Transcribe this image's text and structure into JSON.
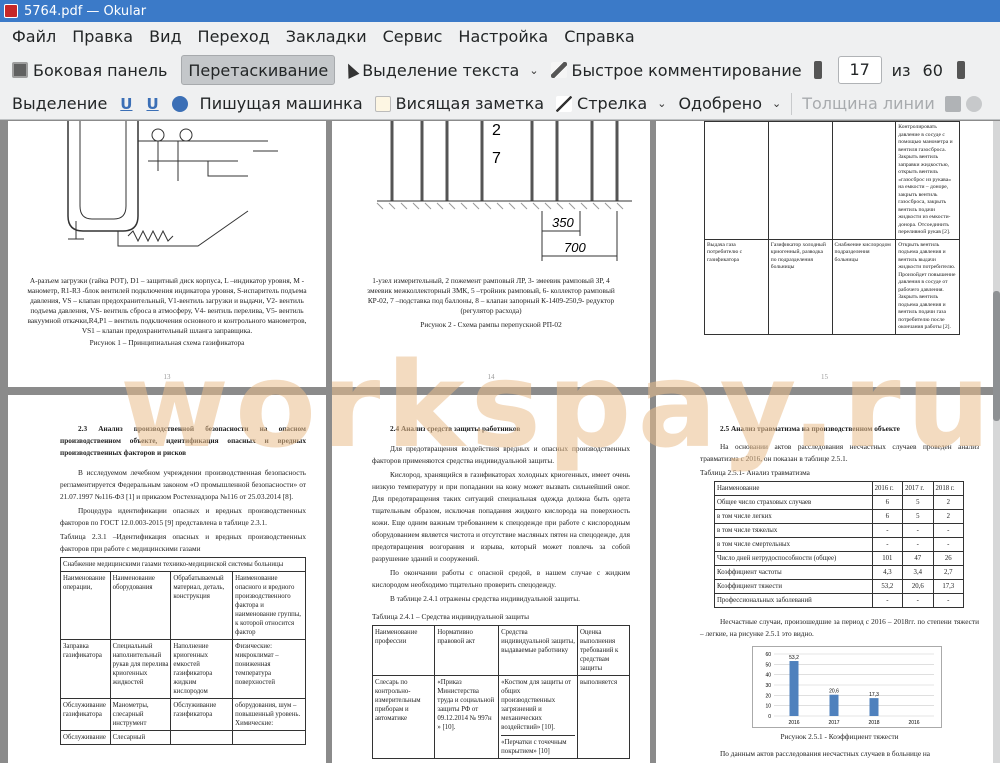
{
  "window": {
    "title": "5764.pdf  — Okular"
  },
  "menu": [
    "Файл",
    "Правка",
    "Вид",
    "Переход",
    "Закладки",
    "Сервис",
    "Настройка",
    "Справка"
  ],
  "toolbar": {
    "sidebar": "Боковая панель",
    "drag": "Перетаскивание",
    "text_select": "Выделение текста",
    "quick_comment": "Быстрое комментирование",
    "page_current": "17",
    "page_of": "из",
    "page_total": "60"
  },
  "annot_toolbar": {
    "highlight": "Выделение",
    "u1": "U",
    "u2": "U",
    "typewriter": "Пишущая машинка",
    "note": "Висящая заметка",
    "arrow": "Стрелка",
    "approved": "Одобрено",
    "line_width": "Толщина линии"
  },
  "watermark": "workspay.ru",
  "pages": {
    "p13": {
      "caption_text": "А-разъем загрузки (гайка РОТ), D1 – защитный диск корпуса, L –индикатор уровня, M - манометр, R1-R3 -блок вентилей подключения индикатора уровня, S-испаритель подъема давления, VS – клапан предохранительный, V1-вентиль загрузки и выдачи, V2- вентиль подъема давления, VS- вентиль сброса в атмосферу, V4- вентиль перелива, V5- вентиль вакуумной откачки,R4,P1 – вентиль подключения основного и контрольного манометров, VS1 – клапан предохранительный шланга заправщика.",
      "figure_title": "Рисунок 1 – Принципиальная схема газификатора",
      "page_no": "13"
    },
    "p14": {
      "dim1": "350",
      "dim2": "700",
      "caption_text": "1-узел измерительный, 2 пожемент рамповый ЛР, 3- змеевик рамповый ЗР, 4 змеевик межколлекторный ЗМК, 5 –тройник рамповый, 6- коллектор рамповый КР-02, 7 –подставка под баллоны, 8 – клапан запорный К-1409-250,9- редуктор (регулятор расхода)",
      "figure_title": "Рисунок 2 - Схема рампы перепускной РП-02",
      "page_no": "14"
    },
    "p15": {
      "top_text": "Контролировать давление в сосуде с помощью манометра и вентиля газосброса. Закрыть вентиль заправки жидкостью, открыть вентиль «газосброс из рукава» на емкости – доноре, закрыть вентиль газосброса, закрыть вентиль подачи жидкости из емкости-донора. Отсоединить переливной рукав [2].",
      "row_c1": "Выдача газа потребителю с газификатора",
      "row_c2": "Газификатор холодный криогенный, разводка по подразделения больницы",
      "row_c3": "Снабжение кислородом подразделения больницы",
      "row_c4": "Открыть вентиль подъема давления и вентиль выдачи жидкости потребителю. Произойдет повышение давления в сосуде от рабочего давления. Закрыть вентиль подъема давления и вентиль подачи газа потребителю после окончания работы [2].",
      "page_no": "15"
    },
    "p16": {
      "heading": "2.3  Анализ производственной безопасности на опасном производственном объекте, идентификация опасных и вредных производственных факторов и рисков",
      "para1": "В исследуемом лечебном учреждении производственная безопасность регламентируется Федеральным законом «О промышленной безопасности» от 21.07.1997 №116-ФЗ [1] и приказом Ростехнадзора №116 от 25.03.2014 [8].",
      "para2": "Процедура идентификации опасных и вредных производственных факторов по ГОСТ 12.0.003-2015 [9] представлена в таблице 2.3.1.",
      "table_title": "Таблица 2.3.1 –Идентификация опасных и вредных производственных факторов при работе с медицинскими газами",
      "table_caption": "Снабжение медицинскими газами технико-медицинской системы больницы",
      "headers": [
        "Наименование операции,",
        "Наименование оборудования",
        "Обрабатываемый материал, деталь, конструкция",
        "Наименование опасного и вредного производственного фактора и наименование группы, к которой относится фактор"
      ],
      "rows": [
        [
          "Заправка газификатора",
          "Специальный наполнительный рукав для перелива криогенных жидкостей",
          "Наполнение криогенных емкостей газификатора жидким кислородом",
          "Физические: микроклимат – пониженная температура поверхностей"
        ],
        [
          "Обслуживание газификатора",
          "Манометры, слесарный инструмент",
          "Обслуживание газификатора",
          "оборудования, шум – повышенный уровень. Химические:"
        ],
        [
          "Обслуживание",
          "Слесарный",
          "",
          ""
        ]
      ],
      "page_no": "16"
    },
    "p17": {
      "heading": "2.4   Анализ средств защиты работников",
      "para1": "Для предотвращения воздействия вредных и опасных производственных факторов применяются средства индивидуальной защиты.",
      "para2": "Кислород, хранящийся в газификаторах холодных криогенных, имеет очень низкую температуру и при попадании на кожу может вызвать сильнейший ожог. Для предотвращения таких ситуаций специальная одежда должна быть одета тщательным образом, исключая попадания жидкого кислорода на поверхность кожи. Еще одним важным требованием к спецодежде при работе с кислородным оборудованием является чистота и отсутствие масляных пятен на спецодежде, для предотвращения возгорания и взрыва, который может повлечь за собой разрушение зданий и сооружений.",
      "para3": "По окончании работы с опасной средой, в нашем случае с жидким кислородом необходимо тщательно проверить спецодежду.",
      "para4": "В таблице 2.4.1 отражены средства индивидуальной защиты.",
      "table_title": "Таблица 2.4.1 – Средства индивидуальной защиты",
      "headers": [
        "Наименование профессии",
        "Нормативно правовой акт",
        "Средства индивидуальной защиты, выдаваемые работнику",
        "Оценка выполнения требований к средствам защиты"
      ],
      "row_c1": "Слесарь по контрольно-измерительным приборам и автоматике",
      "row_c2": "«Приказ Министерства труда и социальной защиты РФ от 09.12.2014 № 997н » [10].",
      "row_c3a": "«Костюм для защиты от общих производственных загрязнений и механических воздействий» [10].",
      "row_c3b": "«Перчатки с точечным покрытием» [10]",
      "row_c4": "выполняется",
      "page_no": "17"
    },
    "p18": {
      "heading": "2.5  Анализ травматизма на производственном объекте",
      "para1": "На основании актов расследования несчастных случаев проведен анализ травматизма с 2016, он показан в таблице 2.5.1.",
      "table_title": "Таблица 2.5.1- Анализ травматизма",
      "headers": [
        "Наименование",
        "2016 г.",
        "2017 г.",
        "2018 г."
      ],
      "rows": [
        [
          "Общее число страховых случаев",
          "6",
          "5",
          "2"
        ],
        [
          "в том числе легких",
          "6",
          "5",
          "2"
        ],
        [
          "в том числе тяжелых",
          "-",
          "-",
          "-"
        ],
        [
          "в том числе смертельных",
          "-",
          "-",
          "-"
        ],
        [
          "Число дней нетрудоспособности (общее)",
          "101",
          "47",
          "26"
        ],
        [
          "Коэффициент частоты",
          "4,3",
          "3,4",
          "2,7"
        ],
        [
          "Коэффициент тяжести",
          "53,2",
          "20,6",
          "17,3"
        ],
        [
          "Профессиональных заболеваний",
          "-",
          "-",
          "-"
        ]
      ],
      "para2": "Несчастные случаи, произошедшие за период с 2016 – 2018гг. по степени тяжести – легкие, на рисунке 2.5.1 это видно.",
      "figure_title": "Рисунок 2.5.1 - Коэффициент тяжести",
      "para3": "По данным актов расследования несчастных случаев в больнице на",
      "page_no": "18"
    }
  },
  "chart_data": {
    "type": "bar",
    "title": "",
    "categories": [
      "2016",
      "2017",
      "2018",
      "2016"
    ],
    "values": [
      53.2,
      20.6,
      17.3,
      0
    ],
    "data_labels": [
      "53,2",
      "20,6",
      "17,3",
      ""
    ],
    "ylim": [
      0,
      60
    ],
    "yticks": [
      "0",
      "10",
      "20",
      "30",
      "40",
      "50",
      "60"
    ],
    "grid": true,
    "bar_color": "#4f81bd"
  }
}
